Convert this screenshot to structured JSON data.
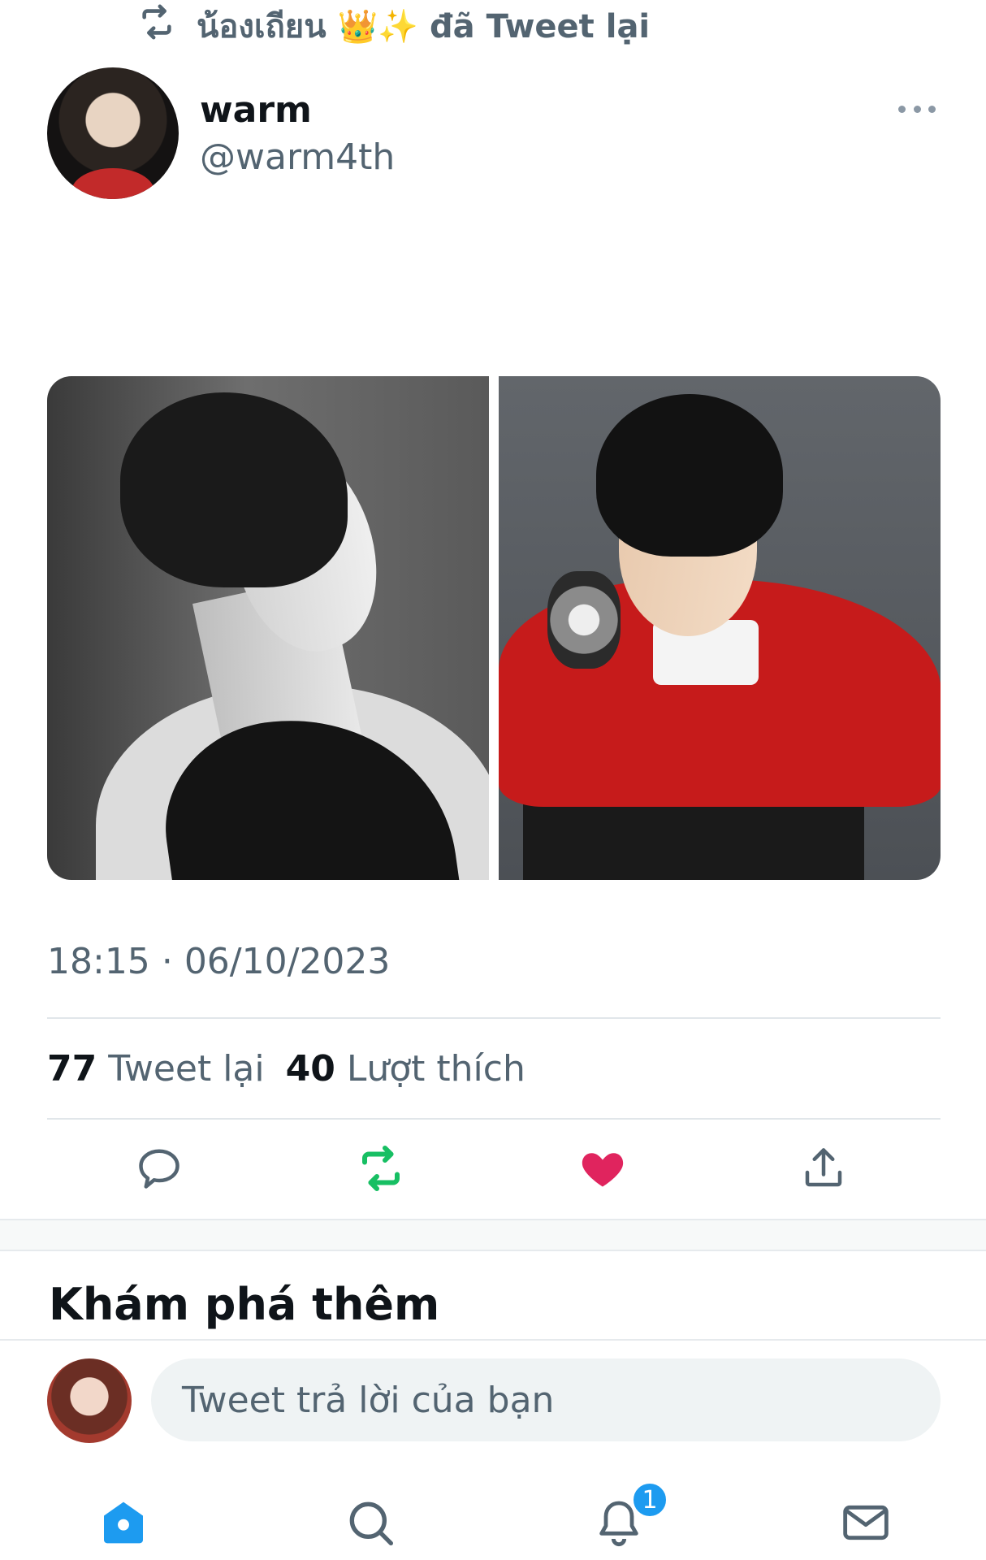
{
  "retweet_context": {
    "text": "น้องเถียน 👑✨ đã Tweet lại",
    "icon": "retweet-icon"
  },
  "author": {
    "name": "warm",
    "handle": "@warm4th"
  },
  "tweet": {
    "emoji_1": "🐺",
    "emoji_2": "🐈"
  },
  "timestamp": {
    "time": "18:15",
    "separator": "·",
    "date": "06/10/2023"
  },
  "stats": {
    "retweets_count": "77",
    "retweets_label": "Tweet lại",
    "likes_count": "40",
    "likes_label": "Lượt thích"
  },
  "actions": {
    "reply_icon": "comment-icon",
    "retweet_icon": "retweet-icon",
    "like_icon": "heart-icon",
    "share_icon": "share-icon",
    "retweet_color": "#17bf63",
    "like_color": "#e0245e"
  },
  "explore": {
    "heading": "Khám phá thêm"
  },
  "reply": {
    "placeholder": "Tweet trả lời của bạn"
  },
  "nav": {
    "items": [
      "home-icon",
      "search-icon",
      "bell-icon",
      "mail-icon"
    ],
    "notification_badge": "1",
    "active_color": "#1d9bf0"
  }
}
